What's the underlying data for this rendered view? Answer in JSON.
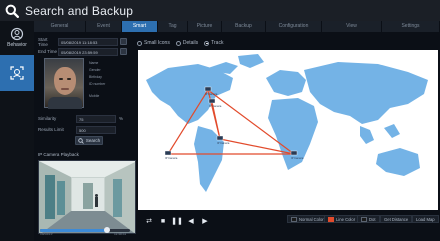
{
  "app": {
    "title": "Search and Backup"
  },
  "tabs": [
    {
      "label": "General",
      "active": false
    },
    {
      "label": "Event",
      "active": false
    },
    {
      "label": "Smart",
      "active": true
    },
    {
      "label": "Tag",
      "active": false
    },
    {
      "label": "Picture",
      "active": false
    },
    {
      "label": "Backup",
      "active": false
    },
    {
      "label": "Configuration",
      "active": false
    },
    {
      "label": "View",
      "active": false
    },
    {
      "label": "Settings",
      "active": false
    }
  ],
  "rail": {
    "items": [
      {
        "label": "Behavior",
        "icon": "behavior-icon"
      },
      {
        "label": "",
        "icon": "face-search-icon",
        "active": true
      }
    ]
  },
  "search": {
    "start_label": "Start Time",
    "start_value": "05/08/2019 11:18:53",
    "end_label": "End Time",
    "end_value": "05/08/2019 23:59:59",
    "options": [
      {
        "label": "Small Icons",
        "selected": false
      },
      {
        "label": "Details",
        "selected": false
      },
      {
        "label": "Track",
        "selected": true
      }
    ],
    "face_meta": [
      "Name",
      "Gender",
      "Birthday",
      "ID number",
      "Mobile"
    ],
    "similarity_label": "Similarity",
    "similarity_value": "75",
    "similarity_unit": "%",
    "limit_label": "Results Limit",
    "limit_value": "500",
    "search_button": "Search"
  },
  "playback": {
    "label": "IP Camera Playback",
    "start_time": "05/08/19",
    "end_time": "11:48:31",
    "progress": 0.74
  },
  "map": {
    "background": "#ffffff",
    "land_color": "#74b3e6",
    "track_color": "#e24b2c",
    "markers": [
      {
        "label": "IP Camera"
      },
      {
        "label": "IP Camera"
      },
      {
        "label": "IP Camera"
      },
      {
        "label": "IP Camera"
      },
      {
        "label": "IP Camera"
      }
    ]
  },
  "controls": {
    "legend": [
      {
        "label": "Normal Color",
        "color": "#1a1a1a"
      },
      {
        "label": "Line Color",
        "color": "#e24b2c"
      },
      {
        "label": "Dot",
        "color": "#1a1a1a"
      },
      {
        "label": "Get Distance"
      },
      {
        "label": "Load Map"
      }
    ]
  }
}
